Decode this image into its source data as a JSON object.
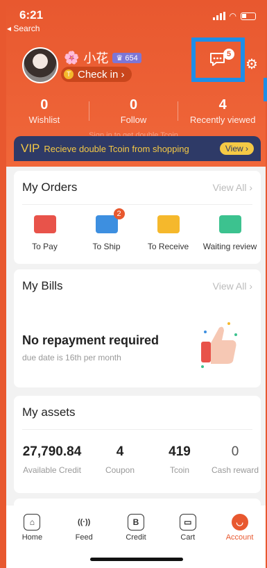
{
  "status": {
    "time": "6:21",
    "back_label": "◂ Search"
  },
  "profile": {
    "name": "小花",
    "flower": "🌸",
    "level": "♛ 654",
    "checkin_label": "Check in ›"
  },
  "messages": {
    "badge": "5"
  },
  "stats": [
    {
      "value": "0",
      "label": "Wishlist"
    },
    {
      "value": "0",
      "label": "Follow"
    },
    {
      "value": "4",
      "label": "Recently viewed"
    }
  ],
  "signin_hint": "Sign in to get double Tcoin",
  "vip": {
    "tag": "VIP",
    "text": "Recieve double Tcoin from shopping",
    "button": "View ›"
  },
  "orders": {
    "title": "My Orders",
    "view_all": "View All  ›",
    "items": [
      {
        "label": "To Pay",
        "color": "#e8534a"
      },
      {
        "label": "To Ship",
        "color": "#3d8fe0",
        "badge": "2"
      },
      {
        "label": "To Receive",
        "color": "#f5b82c"
      },
      {
        "label": "Waiting review",
        "color": "#3cc28f"
      }
    ]
  },
  "bills": {
    "title": "My Bills",
    "view_all": "View All  ›",
    "headline": "No repayment required",
    "subtext": "due date is 16th per month"
  },
  "assets": {
    "title": "My assets",
    "items": [
      {
        "value": "27,790.84",
        "label": "Available Credit"
      },
      {
        "value": "4",
        "label": "Coupon"
      },
      {
        "value": "419",
        "label": "Tcoin"
      },
      {
        "value": "0",
        "label": "Cash reward"
      }
    ]
  },
  "tabs": [
    {
      "label": "Home",
      "icon": "home-icon",
      "glyph": "⌂"
    },
    {
      "label": "Feed",
      "icon": "feed-icon",
      "glyph": "((·))"
    },
    {
      "label": "Credit",
      "icon": "credit-icon",
      "glyph": "B"
    },
    {
      "label": "Cart",
      "icon": "cart-icon",
      "glyph": "▭"
    },
    {
      "label": "Account",
      "icon": "account-icon",
      "glyph": "◡"
    }
  ]
}
